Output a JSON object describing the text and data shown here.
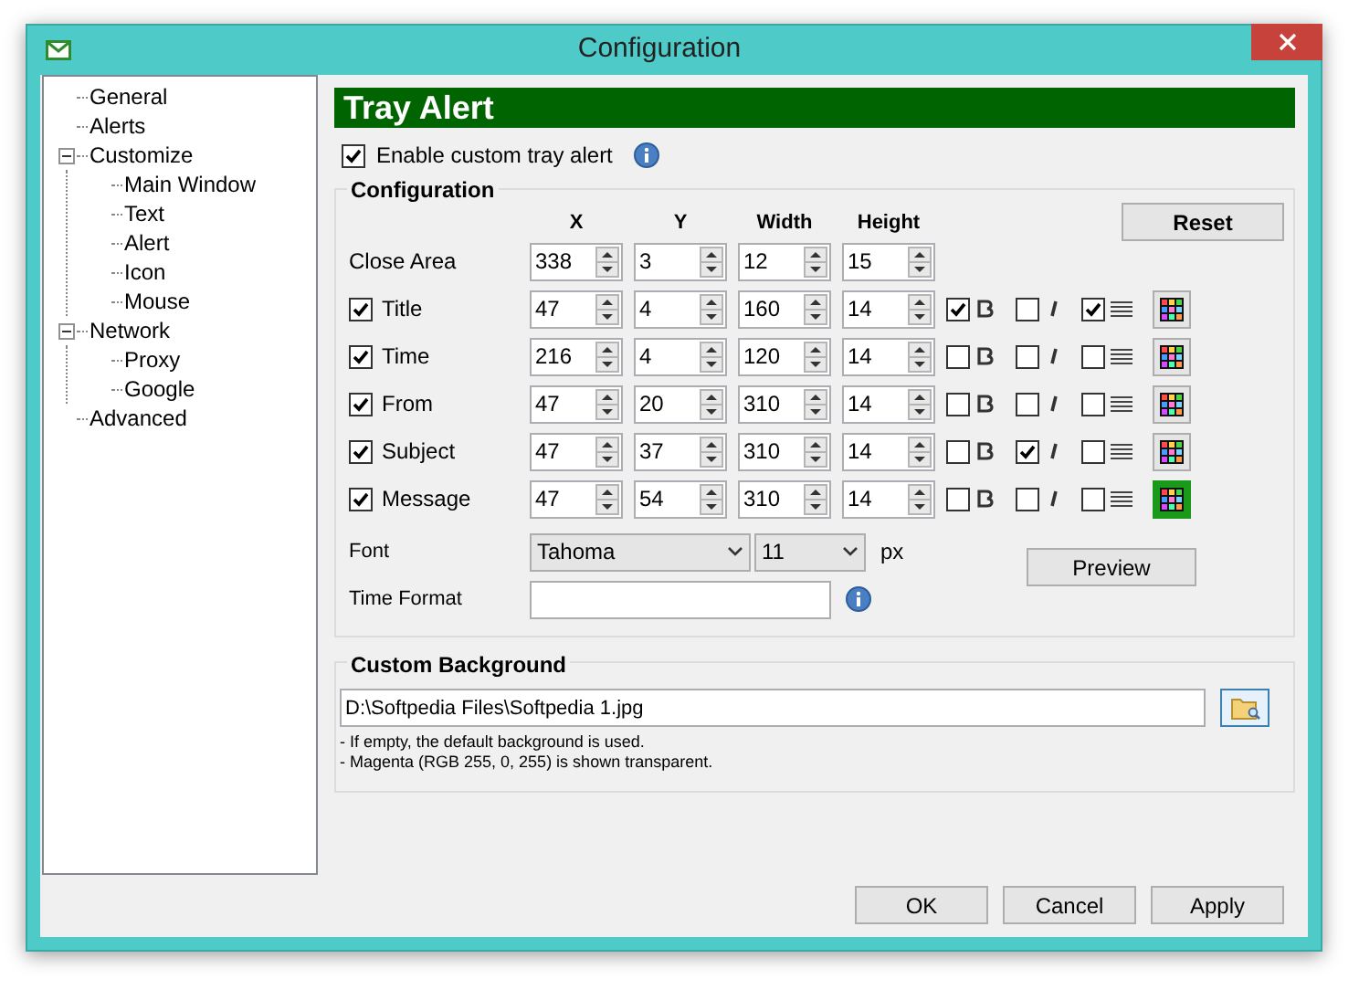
{
  "window": {
    "title": "Configuration"
  },
  "tree": [
    {
      "label": "General",
      "selected": false
    },
    {
      "label": "Alerts",
      "selected": false
    },
    {
      "label": "Customize",
      "selected": false,
      "expanded": true,
      "children": [
        {
          "label": "Main Window",
          "selected": false
        },
        {
          "label": "Text",
          "selected": false
        },
        {
          "label": "Alert",
          "selected": false
        },
        {
          "label": "Icon",
          "selected": false
        },
        {
          "label": "Mouse",
          "selected": false
        }
      ]
    },
    {
      "label": "Network",
      "selected": false,
      "expanded": true,
      "children": [
        {
          "label": "Proxy",
          "selected": false
        },
        {
          "label": "Google",
          "selected": false
        }
      ]
    },
    {
      "label": "Advanced",
      "selected": false
    }
  ],
  "header": "Tray Alert",
  "enable": {
    "label": "Enable custom tray alert",
    "checked": true
  },
  "configuration": {
    "title": "Configuration",
    "columns": [
      "X",
      "Y",
      "Width",
      "Height"
    ],
    "reset": "Reset",
    "rows": [
      {
        "kind": "area",
        "label": "Close Area",
        "values": [
          "338",
          "3",
          "12",
          "15"
        ]
      },
      {
        "kind": "element",
        "label": "Title",
        "checked": true,
        "values": [
          "47",
          "4",
          "160",
          "14"
        ],
        "bold": true,
        "italic": false,
        "align": true,
        "color_selected": false
      },
      {
        "kind": "element",
        "label": "Time",
        "checked": true,
        "values": [
          "216",
          "4",
          "120",
          "14"
        ],
        "bold": false,
        "italic": false,
        "align": false,
        "color_selected": false
      },
      {
        "kind": "element",
        "label": "From",
        "checked": true,
        "values": [
          "47",
          "20",
          "310",
          "14"
        ],
        "bold": false,
        "italic": false,
        "align": false,
        "color_selected": false
      },
      {
        "kind": "element",
        "label": "Subject",
        "checked": true,
        "values": [
          "47",
          "37",
          "310",
          "14"
        ],
        "bold": false,
        "italic": true,
        "align": false,
        "color_selected": false
      },
      {
        "kind": "element",
        "label": "Message",
        "checked": true,
        "values": [
          "47",
          "54",
          "310",
          "14"
        ],
        "bold": false,
        "italic": false,
        "align": false,
        "color_selected": true
      }
    ],
    "font_label": "Font",
    "font": "Tahoma",
    "size": "11",
    "unit": "px",
    "time_format_label": "Time Format",
    "preview": "Preview"
  },
  "background": {
    "title": "Custom Background",
    "path": "D:\\Softpedia Files\\Softpedia 1.jpg",
    "notes": [
      "- If empty, the default background is used.",
      "- Magenta (RGB 255, 0, 255) is shown transparent."
    ]
  },
  "buttons": [
    "OK",
    "Cancel",
    "Apply"
  ]
}
